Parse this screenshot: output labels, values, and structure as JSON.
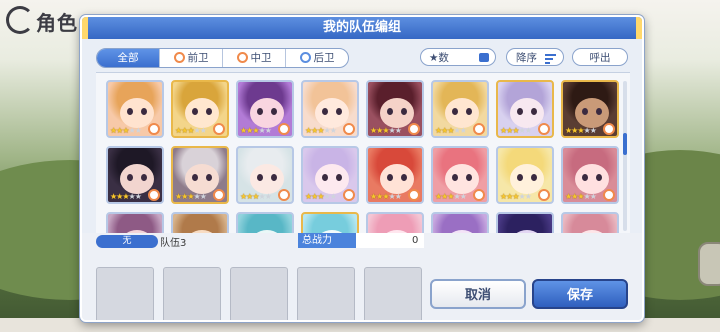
{
  "screen": {
    "corner_title": "角色"
  },
  "dialog": {
    "title": "我的队伍编组",
    "tabs": [
      {
        "label": "全部",
        "active": true
      },
      {
        "label": "前卫",
        "active": false
      },
      {
        "label": "中卫",
        "active": false
      },
      {
        "label": "后卫",
        "active": false
      }
    ],
    "sort_attribute": "★数",
    "sort_order": "降序",
    "summon_label": "呼出"
  },
  "roster": [
    {
      "stars": 3,
      "frame": "blue",
      "rank": "orange",
      "bg": "#f7c9a8",
      "face": "#ffe3cf",
      "hair": "#e7a45a"
    },
    {
      "stars": 3,
      "frame": "gold",
      "rank": "orange",
      "bg": "#f3d58a",
      "face": "#ffe7cf",
      "hair": "#d9a53b"
    },
    {
      "stars": 3,
      "frame": "blue",
      "rank": "orange",
      "bg": "#b27bd6",
      "face": "#f9d5e0",
      "hair": "#6d3a8f"
    },
    {
      "stars": 3,
      "frame": "blue",
      "rank": "orange",
      "bg": "#f7dccd",
      "face": "#ffe9dd",
      "hair": "#f2c398"
    },
    {
      "stars": 3,
      "frame": "blue",
      "rank": "orange",
      "bg": "#9a5060",
      "face": "#f5d2c8",
      "hair": "#5a1f2c"
    },
    {
      "stars": 3,
      "frame": "blue",
      "rank": "orange",
      "bg": "#f2d9a0",
      "face": "#ffe6d0",
      "hair": "#e3b657"
    },
    {
      "stars": 3,
      "frame": "gold",
      "rank": "orange",
      "bg": "#d8d1ef",
      "face": "#f7e8f0",
      "hair": "#b3a4d8"
    },
    {
      "stars": 3,
      "frame": "gold",
      "rank": "orange",
      "bg": "#5a3d33",
      "face": "#c99a78",
      "hair": "#2e1a14"
    },
    {
      "stars": 3,
      "frame": "blue",
      "rank": "orange",
      "bg": "#3a2f44",
      "face": "#f2d5cf",
      "hair": "#1e1826"
    },
    {
      "stars": 3,
      "frame": "gold",
      "rank": "orange",
      "bg": "#8e7b8a",
      "face": "#f6dcd2",
      "hair": "#d9d2d8"
    },
    {
      "stars": 3,
      "frame": "blue",
      "rank": "orange",
      "bg": "#d6e3e6",
      "face": "#fbe9e3",
      "hair": "#e8ecef"
    },
    {
      "stars": 3,
      "frame": "blue",
      "rank": "orange",
      "bg": "#d9c8ec",
      "face": "#fde9ef",
      "hair": "#c9b4e6"
    },
    {
      "stars": 3,
      "frame": "blue",
      "rank": "orange",
      "bg": "#e97a62",
      "face": "#ffe2d6",
      "hair": "#d8493a"
    },
    {
      "stars": 3,
      "frame": "blue",
      "rank": "orange",
      "bg": "#ef9ea4",
      "face": "#ffe4e0",
      "hair": "#e9737f"
    },
    {
      "stars": 3,
      "frame": "blue",
      "rank": "orange",
      "bg": "#f6e7a8",
      "face": "#fff1dc",
      "hair": "#f4d97a"
    },
    {
      "stars": 3,
      "frame": "blue",
      "rank": "orange",
      "bg": "#d98c98",
      "face": "#ffe0e0",
      "hair": "#c76b7f"
    },
    {
      "stars": 0,
      "frame": "blue",
      "rank": "none",
      "bg": "#c7a7c4",
      "face": "#f3d4d9",
      "hair": "#8e5a85"
    },
    {
      "stars": 0,
      "frame": "blue",
      "rank": "none",
      "bg": "#d8b48d",
      "face": "#f8dcc3",
      "hair": "#b07a4a"
    },
    {
      "stars": 0,
      "frame": "blue",
      "rank": "none",
      "bg": "#92d3dd",
      "face": "#eaf7f7",
      "hair": "#58b7c6"
    },
    {
      "stars": 0,
      "frame": "gold",
      "rank": "none",
      "bg": "#b7e7f0",
      "face": "#f2fbfc",
      "hair": "#77cddd"
    },
    {
      "stars": 0,
      "frame": "blue",
      "rank": "none",
      "bg": "#f4c6d4",
      "face": "#ffe6ee",
      "hair": "#ee9db6"
    },
    {
      "stars": 0,
      "frame": "blue",
      "rank": "none",
      "bg": "#c8a9e0",
      "face": "#f3e3f7",
      "hair": "#9a6fc4"
    },
    {
      "stars": 0,
      "frame": "blue",
      "rank": "none",
      "bg": "#4a3a86",
      "face": "#e3d6f3",
      "hair": "#2c2160"
    },
    {
      "stars": 0,
      "frame": "blue",
      "rank": "none",
      "bg": "#e9b9c2",
      "face": "#fde5e8",
      "hair": "#d78a9a"
    }
  ],
  "team": {
    "slot_label": "无",
    "name": "队伍3",
    "power_label": "总战力",
    "power_value": "0",
    "empty_slots": 5
  },
  "actions": {
    "cancel": "取消",
    "save": "保存"
  },
  "colors": {
    "accent": "#3b6fcf",
    "gold_frame": "#e9b84a",
    "blue_frame": "#b7c8e6"
  }
}
